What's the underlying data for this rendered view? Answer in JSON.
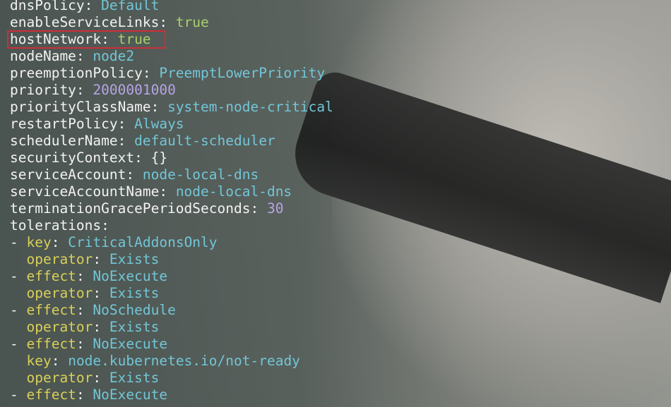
{
  "lines": [
    {
      "indent": "",
      "dash": "",
      "key": "dnsPolicy",
      "sep": ": ",
      "value": "Default",
      "vtype": "str"
    },
    {
      "indent": "",
      "dash": "",
      "key": "enableServiceLinks",
      "sep": ": ",
      "value": "true",
      "vtype": "bool"
    },
    {
      "indent": "",
      "dash": "",
      "key": "hostNetwork",
      "sep": ": ",
      "value": "true",
      "vtype": "bool"
    },
    {
      "indent": "",
      "dash": "",
      "key": "nodeName",
      "sep": ": ",
      "value": "node2",
      "vtype": "str"
    },
    {
      "indent": "",
      "dash": "",
      "key": "preemptionPolicy",
      "sep": ": ",
      "value": "PreemptLowerPriority",
      "vtype": "str"
    },
    {
      "indent": "",
      "dash": "",
      "key": "priority",
      "sep": ": ",
      "value": "2000001000",
      "vtype": "num"
    },
    {
      "indent": "",
      "dash": "",
      "key": "priorityClassName",
      "sep": ": ",
      "value": "system-node-critical",
      "vtype": "str"
    },
    {
      "indent": "",
      "dash": "",
      "key": "restartPolicy",
      "sep": ": ",
      "value": "Always",
      "vtype": "str"
    },
    {
      "indent": "",
      "dash": "",
      "key": "schedulerName",
      "sep": ": ",
      "value": "default-scheduler",
      "vtype": "str"
    },
    {
      "indent": "",
      "dash": "",
      "key": "securityContext",
      "sep": ": ",
      "value": "{}",
      "vtype": "plain"
    },
    {
      "indent": "",
      "dash": "",
      "key": "serviceAccount",
      "sep": ": ",
      "value": "node-local-dns",
      "vtype": "str"
    },
    {
      "indent": "",
      "dash": "",
      "key": "serviceAccountName",
      "sep": ": ",
      "value": "node-local-dns",
      "vtype": "str"
    },
    {
      "indent": "",
      "dash": "",
      "key": "terminationGracePeriodSeconds",
      "sep": ": ",
      "value": "30",
      "vtype": "num"
    },
    {
      "indent": "",
      "dash": "",
      "key": "tolerations",
      "sep": ":",
      "value": "",
      "vtype": "plain"
    },
    {
      "indent": "",
      "dash": "- ",
      "key": "key",
      "sep": ": ",
      "value": "CriticalAddonsOnly",
      "vtype": "str",
      "listkey": true
    },
    {
      "indent": "  ",
      "dash": "",
      "key": "operator",
      "sep": ": ",
      "value": "Exists",
      "vtype": "str",
      "listkey": true
    },
    {
      "indent": "",
      "dash": "- ",
      "key": "effect",
      "sep": ": ",
      "value": "NoExecute",
      "vtype": "str",
      "listkey": true
    },
    {
      "indent": "  ",
      "dash": "",
      "key": "operator",
      "sep": ": ",
      "value": "Exists",
      "vtype": "str",
      "listkey": true
    },
    {
      "indent": "",
      "dash": "- ",
      "key": "effect",
      "sep": ": ",
      "value": "NoSchedule",
      "vtype": "str",
      "listkey": true
    },
    {
      "indent": "  ",
      "dash": "",
      "key": "operator",
      "sep": ": ",
      "value": "Exists",
      "vtype": "str",
      "listkey": true
    },
    {
      "indent": "",
      "dash": "- ",
      "key": "effect",
      "sep": ": ",
      "value": "NoExecute",
      "vtype": "str",
      "listkey": true
    },
    {
      "indent": "  ",
      "dash": "",
      "key": "key",
      "sep": ": ",
      "value": "node.kubernetes.io/not-ready",
      "vtype": "str",
      "listkey": true
    },
    {
      "indent": "  ",
      "dash": "",
      "key": "operator",
      "sep": ": ",
      "value": "Exists",
      "vtype": "str",
      "listkey": true
    },
    {
      "indent": "",
      "dash": "- ",
      "key": "effect",
      "sep": ": ",
      "value": "NoExecute",
      "vtype": "str",
      "listkey": true
    }
  ],
  "highlighted_line_index": 2,
  "colors": {
    "key": "#f2f2f2",
    "list_key": "#d8cf5a",
    "string": "#72c6d8",
    "bool": "#a9d06a",
    "number": "#b7a3e6",
    "highlight_border": "#cc2f3a"
  }
}
